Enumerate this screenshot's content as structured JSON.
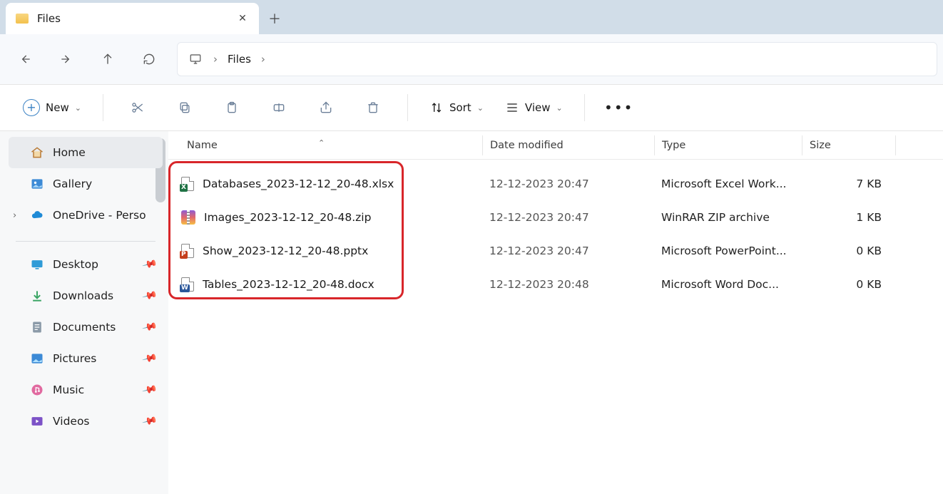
{
  "tab": {
    "title": "Files"
  },
  "breadcrumb": {
    "location": "Files"
  },
  "toolbar": {
    "new": "New",
    "sort": "Sort",
    "view": "View"
  },
  "sidebar": {
    "home": "Home",
    "gallery": "Gallery",
    "onedrive": "OneDrive - Perso",
    "desktop": "Desktop",
    "downloads": "Downloads",
    "documents": "Documents",
    "pictures": "Pictures",
    "music": "Music",
    "videos": "Videos"
  },
  "columns": {
    "name": "Name",
    "date": "Date modified",
    "type": "Type",
    "size": "Size"
  },
  "files": [
    {
      "name": "Databases_2023-12-12_20-48.xlsx",
      "date": "12-12-2023 20:47",
      "type": "Microsoft Excel Work...",
      "size": "7 KB",
      "kind": "xlsx"
    },
    {
      "name": "Images_2023-12-12_20-48.zip",
      "date": "12-12-2023 20:47",
      "type": "WinRAR ZIP archive",
      "size": "1 KB",
      "kind": "zip"
    },
    {
      "name": "Show_2023-12-12_20-48.pptx",
      "date": "12-12-2023 20:47",
      "type": "Microsoft PowerPoint...",
      "size": "0 KB",
      "kind": "pptx"
    },
    {
      "name": "Tables_2023-12-12_20-48.docx",
      "date": "12-12-2023 20:48",
      "type": "Microsoft Word Doc...",
      "size": "0 KB",
      "kind": "docx"
    }
  ]
}
